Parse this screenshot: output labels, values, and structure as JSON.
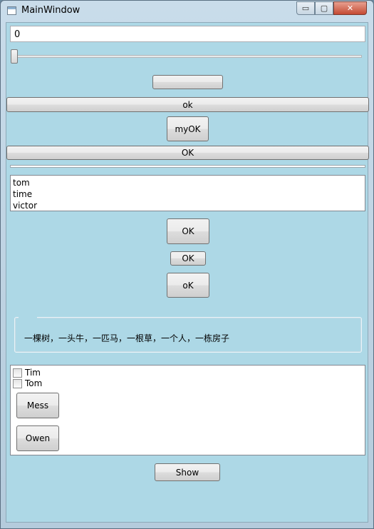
{
  "window": {
    "title": "MainWindow",
    "min_glyph": "▭",
    "max_glyph": "▢",
    "close_glyph": "✕"
  },
  "textbox": {
    "value": "0"
  },
  "slider": {
    "value": 0
  },
  "buttons": {
    "empty": "",
    "ok_wide": "ok",
    "myok": "myOK",
    "ok_wide2": "OK",
    "ok_large": "OK",
    "ok_small": "OK",
    "ok_mixed": "oK",
    "show": "Show"
  },
  "list": {
    "items": [
      "tom",
      "time",
      "victor"
    ]
  },
  "groupbox": {
    "text": "一棵树，一头牛，一匹马，一根草，一个人，一栋房子"
  },
  "panel": {
    "checkboxes": [
      {
        "label": "Tim",
        "checked": false
      },
      {
        "label": "Tom",
        "checked": false
      }
    ],
    "buttons": [
      "Mess",
      "Owen"
    ]
  }
}
